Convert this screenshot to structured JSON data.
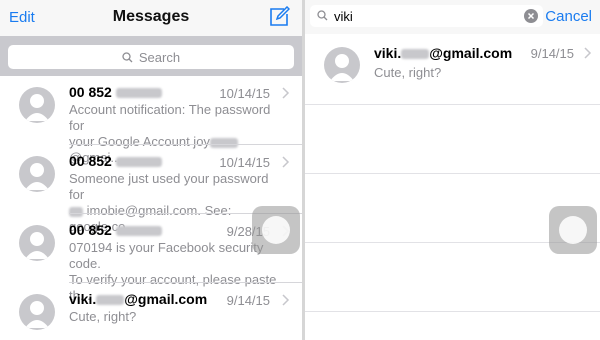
{
  "left": {
    "edit_label": "Edit",
    "title": "Messages",
    "search_placeholder": "Search",
    "messages": [
      {
        "sender": "00 852",
        "date": "10/14/15",
        "line1": "Account notification: The password for",
        "line2a": "your Google Account joy",
        "line2b": "@gmai..."
      },
      {
        "sender": "00 852",
        "date": "10/14/15",
        "line1": "Someone just used your password for",
        "line2a": "imobie@gmail.com. See: google.co..."
      },
      {
        "sender": "00 852",
        "date": "9/28/15",
        "line1": "070194 is your Facebook security code.",
        "line2a": "To verify your account, please paste th..."
      },
      {
        "sender_a": "viki.",
        "sender_b": "@gmail.com",
        "date": "9/14/15",
        "line1": "Cute, right?"
      }
    ]
  },
  "right": {
    "search_value": "viki",
    "cancel_label": "Cancel",
    "result": {
      "sender_a": "viki.",
      "sender_b": "@gmail.com",
      "date": "9/14/15",
      "preview": "Cute, right?"
    }
  },
  "colors": {
    "accent": "#1a7cf0",
    "secondary_text": "#8e8e93",
    "search_bg": "#c9c9ce"
  }
}
